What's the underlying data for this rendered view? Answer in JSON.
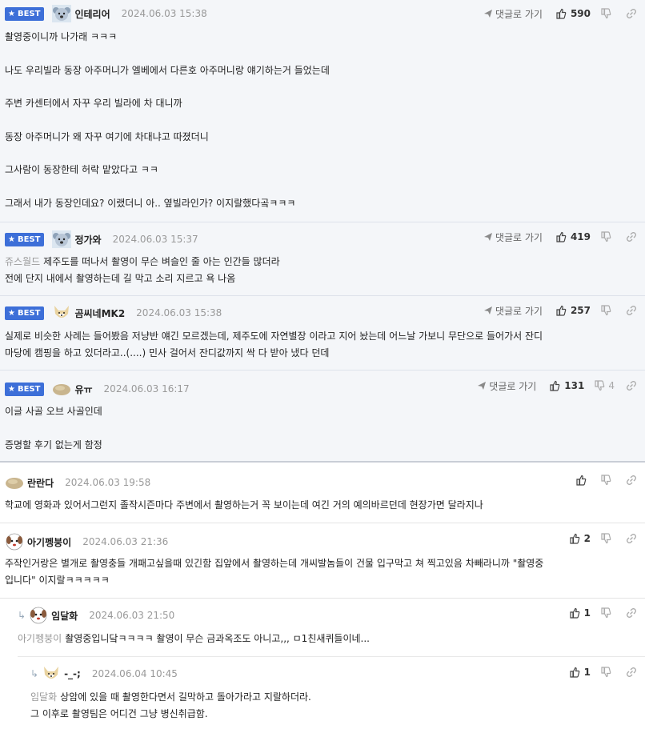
{
  "labels": {
    "best": "BEST",
    "reply_link": "댓글로 가기"
  },
  "colors": {
    "best_badge": "#3d6fd8",
    "best_bg": "#f4f6f9"
  },
  "comments": [
    {
      "best": true,
      "nick": "인테리어",
      "avatar": "koala-avatar",
      "date": "2024.06.03 15:38",
      "likes": "590",
      "dislikes": "",
      "lines": [
        "촬영중이니까 나가래 ㅋㅋㅋ",
        "",
        "나도 우리빌라 동장 아주머니가 엘베에서 다른호 아주머니랑 얘기하는거 들었는데",
        "",
        "주변 카센터에서 자꾸 우리 빌라에 차 대니까",
        "",
        "동장 아주머니가 왜 자꾸 여기에 차대냐고 따졌더니",
        "",
        "그사람이 동장한테 허락 맡았다고 ㅋㅋ",
        "",
        "그래서 내가 동장인데요? 이랬더니 아.. 옆빌라인가? 이지랄했다곸ㅋㅋㅋ"
      ]
    },
    {
      "best": true,
      "nick": "정가와",
      "avatar": "koala-avatar",
      "date": "2024.06.03 15:37",
      "likes": "419",
      "dislikes": "",
      "mention": "쥬스월드",
      "lines": [
        "제주도를 떠나서 촬영이 무슨 벼슬인 줄 아는 인간들 많더라",
        "전에 단지 내에서 촬영하는데 길 막고 소리 지르고 욕 나옴"
      ]
    },
    {
      "best": true,
      "nick": "곰씨네MK2",
      "avatar": "dog-avatar",
      "date": "2024.06.03 15:38",
      "likes": "257",
      "dislikes": "",
      "lines": [
        "실제로 비슷한 사례는 들어봤음 저냥반 얘긴 모르겠는데, 제주도에 자연별장 이라고 지어 놨는데 어느날 가보니 무단으로 들어가서 잔디",
        "마당에 캠핑을 하고 있더라고..(....) 민사 걸어서 잔디값까지 싹 다 받아 냈다 던데"
      ]
    },
    {
      "best": true,
      "nick": "유ㅠ",
      "avatar": "potato-avatar",
      "date": "2024.06.03 16:17",
      "likes": "131",
      "dislikes": "4",
      "lines": [
        "이글 사골 오브 사골인데",
        "",
        "증명할 후기 없는게 함정"
      ]
    },
    {
      "best": false,
      "nick": "란란다",
      "avatar": "potato-avatar",
      "date": "2024.06.03 19:58",
      "likes": "",
      "dislikes": "",
      "lines": [
        "학교에 영화과 있어서그런지 졸작시즌마다 주변에서 촬영하는거 꼭 보이는데 여긴 거의 예의바르던데 현장가면 달라지나"
      ]
    },
    {
      "best": false,
      "nick": "아기펭붕이",
      "avatar": "dog-face-avatar",
      "date": "2024.06.03 21:36",
      "likes": "2",
      "dislikes": "",
      "lines": [
        "주작인거랑은 별개로 촬영충들 개패고싶을때 있긴함 집앞에서 촬영하는데 개씨발놈들이 건물 입구막고 쳐 찍고있음 차빼라니까 \"촬영중",
        "입니다\" 이지랄ㅋㅋㅋㅋㅋ"
      ]
    },
    {
      "best": false,
      "nick": "임달화",
      "avatar": "dog-face-avatar",
      "date": "2024.06.03 21:50",
      "likes": "1",
      "dislikes": "",
      "mention": "아기펭붕이",
      "lines": [
        "촬영중입니닼ㅋㅋㅋㅋ 촬영이 무슨 금과옥조도 아니고,,, ㅁ1친새퀴들이네..."
      ]
    },
    {
      "best": false,
      "nick": "-_-;",
      "avatar": "dog-avatar",
      "date": "2024.06.04 10:45",
      "likes": "1",
      "dislikes": "",
      "mention": "임달화",
      "lines": [
        "상암에 있을 때 촬영한다면서 길막하고 돌아가라고 지랄하더라.",
        "그 이후로 촬영팀은 어디건 그냥 병신취급함."
      ]
    }
  ]
}
